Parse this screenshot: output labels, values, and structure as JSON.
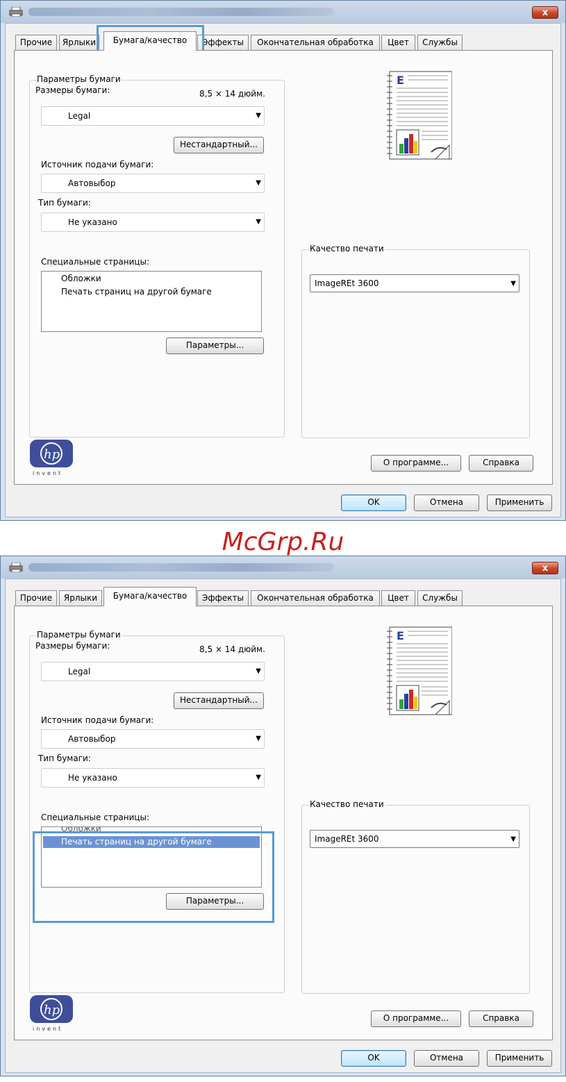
{
  "watermark": "McGrp.Ru",
  "colors": {
    "accent": "#5a9bd4",
    "selection": "#6b93d4",
    "close": "#c9432a",
    "hp_blue": "#3f4e9a"
  },
  "dialogs": [
    {
      "close_label": "x",
      "tabs": [
        "Прочие",
        "Ярлыки",
        "Бумага/качество",
        "Эффекты",
        "Окончательная обработка",
        "Цвет",
        "Службы"
      ],
      "active_tab": "Бумага/качество",
      "highlight": "tab-paper-quality",
      "paper_group": {
        "legend": "Параметры бумаги",
        "size_label": "Размеры бумаги:",
        "size_value": "8,5 × 14 дюйм.",
        "size_select": "Legal",
        "custom_button": "Нестандартный...",
        "source_label": "Источник подачи бумаги:",
        "source_select": "Автовыбор",
        "type_label": "Тип бумаги:",
        "type_select": "Не указано",
        "special_label": "Специальные страницы:",
        "special_items": [
          "Обложки",
          "Печать страниц на другой бумаге"
        ],
        "selected_index": -1,
        "params_button": "Параметры..."
      },
      "quality_group": {
        "legend": "Качество печати",
        "select": "ImageREt 3600"
      },
      "logo_text": "invent",
      "about_button": "О программе...",
      "help_button": "Справка",
      "ok_button": "OK",
      "cancel_button": "Отмена",
      "apply_button": "Применить"
    },
    {
      "close_label": "x",
      "tabs": [
        "Прочие",
        "Ярлыки",
        "Бумага/качество",
        "Эффекты",
        "Окончательная обработка",
        "Цвет",
        "Службы"
      ],
      "active_tab": "Бумага/качество",
      "highlight": "special-pages-list",
      "paper_group": {
        "legend": "Параметры бумаги",
        "size_label": "Размеры бумаги:",
        "size_value": "8,5 × 14 дюйм.",
        "size_select": "Legal",
        "custom_button": "Нестандартный...",
        "source_label": "Источник подачи бумаги:",
        "source_select": "Автовыбор",
        "type_label": "Тип бумаги:",
        "type_select": "Не указано",
        "special_label": "Специальные страницы:",
        "special_items": [
          "Обложки",
          "Печать страниц на другой бумаге"
        ],
        "selected_index": 1,
        "params_button": "Параметры..."
      },
      "quality_group": {
        "legend": "Качество печати",
        "select": "ImageREt 3600"
      },
      "logo_text": "invent",
      "about_button": "О программе...",
      "help_button": "Справка",
      "ok_button": "OK",
      "cancel_button": "Отмена",
      "apply_button": "Применить"
    }
  ]
}
